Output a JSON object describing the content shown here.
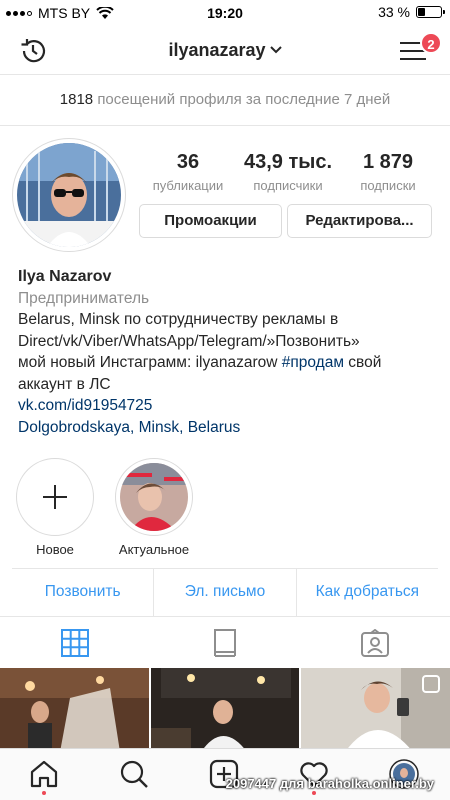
{
  "status_bar": {
    "carrier": "MTS BY",
    "time": "19:20",
    "battery_percent": "33 %",
    "battery_level": 0.33,
    "signal_icon": "signal-icon",
    "wifi_icon": "wifi-icon"
  },
  "header": {
    "username": "ilyanazaray",
    "notification_count": "2",
    "history_icon": "history-icon",
    "menu_icon": "menu-icon"
  },
  "visits": {
    "count": "1818",
    "text": "посещений профиля за последние 7 дней"
  },
  "stats": [
    {
      "value": "36",
      "label": "публикации"
    },
    {
      "value": "43,9 тыс.",
      "label": "подписчики"
    },
    {
      "value": "1 879",
      "label": "подписки"
    }
  ],
  "buttons": {
    "promo": "Промоакции",
    "edit": "Редактирова..."
  },
  "bio": {
    "name": "Ilya Nazarov",
    "category": "Предприниматель",
    "line1": "Belarus, Minsk по сотрудничеству рекламы в",
    "line2": "Direct/vk/Viber/WhatsApp/Telegram/»Позвонить»",
    "line3a": "мой новый Инстаграмм: ilyanazarow ",
    "hashtag": "#продам",
    "line3b": " свой",
    "line4": "аккаунт в ЛС",
    "link": "vk.com/id91954725",
    "address": "Dolgobrodskaya, Minsk, Belarus"
  },
  "highlights": [
    {
      "label": "Новое"
    },
    {
      "label": "Актуальное"
    }
  ],
  "contacts": {
    "call": "Позвонить",
    "email": "Эл. письмо",
    "directions": "Как добраться"
  },
  "tabs": {
    "grid": "grid-icon",
    "feed": "feed-icon",
    "tagged": "tagged-icon"
  },
  "bottom_nav": [
    "home-icon",
    "search-icon",
    "add-icon",
    "heart-icon",
    "profile-icon"
  ],
  "watermark": "2097447 для baraholka.onliner.by",
  "colors": {
    "link": "#003569",
    "action": "#3897f0",
    "badge": "#ed4956",
    "muted": "#8e8e8e"
  }
}
